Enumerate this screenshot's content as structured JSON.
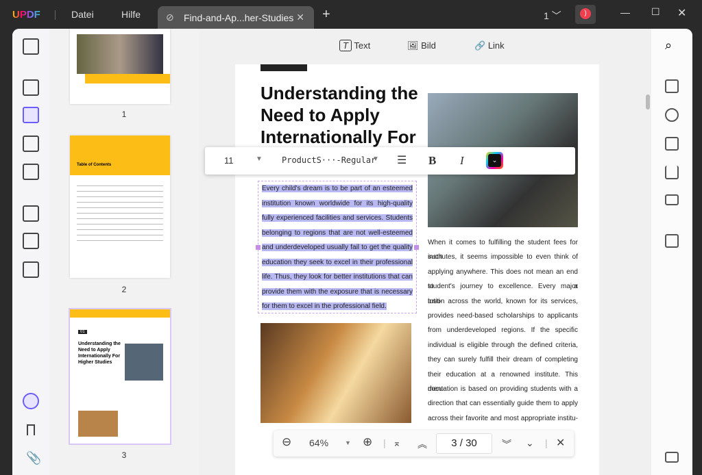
{
  "app": {
    "logo": "UPDF",
    "menu": [
      "Datei",
      "Hilfe"
    ],
    "tab_title": "Find-and-Ap...her-Studies",
    "page_indicator": "1"
  },
  "thumbnails": {
    "pages": [
      "1",
      "2",
      "3"
    ],
    "toc_title": "Table of Contents",
    "page3_title": "Understanding the Need to Apply Internationally For Higher Studies",
    "page3_num": "01"
  },
  "edit_toolbar": {
    "text": "Text",
    "image": "Bild",
    "link": "Link"
  },
  "format_bar": {
    "font_size": "11",
    "font_name": "ProductS···-Regular",
    "bold": "B",
    "italic": "I"
  },
  "document": {
    "title": "Understanding the Need to Apply Internationally For",
    "selected_lines": [
      "Every child's dream is to be part of an esteemed",
      "institution known worldwide for its high-quality and",
      "fully experienced facilities and services. Students",
      "belonging to regions that are not well-esteemed",
      "and underdeveloped usually fail to get the quality",
      "education they seek to excel in their professional",
      "life. Thus, they look for better institutions that can",
      "provide them with the exposure that is necessary",
      "for them to excel in the professional field."
    ],
    "right_lines": [
      "When it comes to fulfilling the student fees for such",
      "institutes, it seems impossible to even think of",
      "applying anywhere. This does not mean an end to a",
      "student's journey to excellence. Every major insti-",
      "tution across the world, known for its services,",
      "provides need-based scholarships to applicants",
      "from underdeveloped regions. If the specific",
      "individual is eligible through the defined criteria,",
      "they can surely fulfill their dream of completing",
      "their education at a renowned institute. This docu-",
      "mentation is based on providing students with a",
      "direction that can essentially guide them to apply",
      "across their favorite and most appropriate institu-"
    ]
  },
  "bottom_bar": {
    "zoom": "64%",
    "current_page": "3",
    "total_pages": "30",
    "page_sep": "/"
  },
  "colors": {
    "accent": "#6a5cff",
    "selection": "#b8b8f2",
    "toc_yellow": "#fbbd16"
  }
}
